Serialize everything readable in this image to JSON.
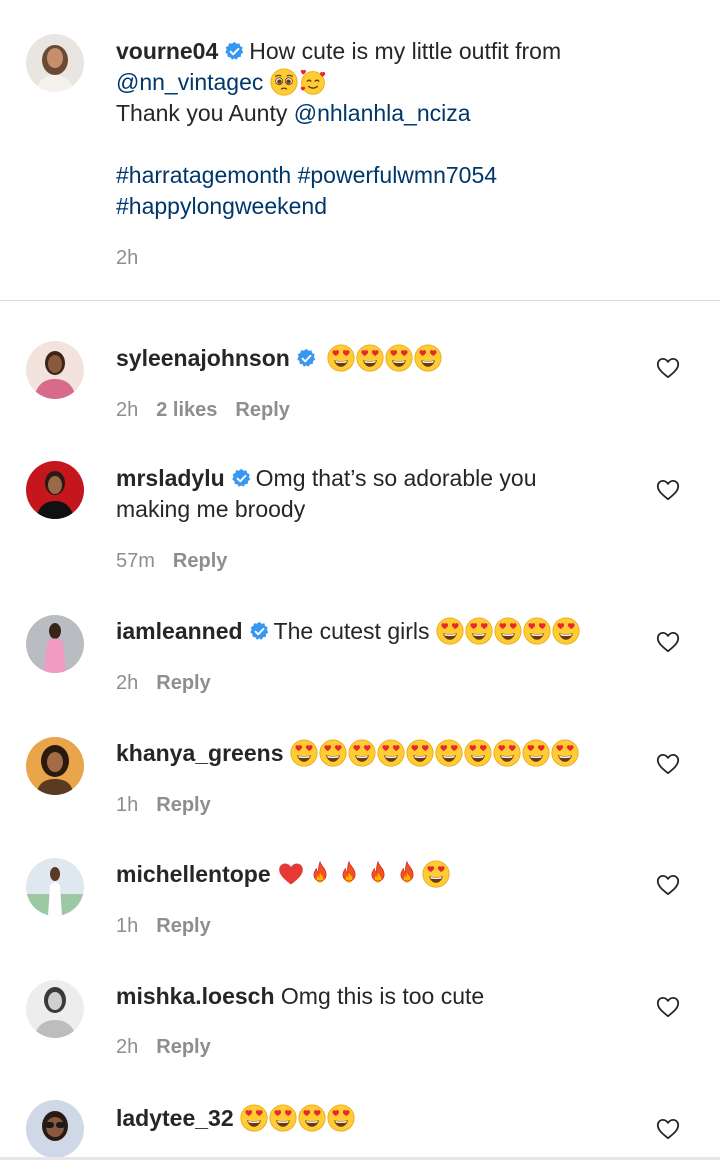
{
  "caption": {
    "username": "vourne04",
    "text_line1": "How cute is my little outfit from",
    "mention1": "@nn_vintagec",
    "text_line2": "Thank you Aunty",
    "mention2": "@nhlanhla_nciza",
    "hashtag1": "#harratagemonth",
    "hashtag2": "#powerfulwmn7054",
    "hashtag3": "#happylongweekend",
    "time": "2h",
    "verified": true,
    "emojis": [
      "pleading-face",
      "smiling-face-with-hearts"
    ]
  },
  "comments": [
    {
      "username": "syleenajohnson",
      "verified": true,
      "text": "",
      "emojis": [
        "heart-eyes",
        "heart-eyes",
        "heart-eyes",
        "heart-eyes"
      ],
      "time": "2h",
      "likes": "2 likes",
      "reply": "Reply"
    },
    {
      "username": "mrsladylu",
      "verified": true,
      "text_line1": "Omg that’s so adorable you",
      "text_line2": "making me broody",
      "time": "57m",
      "reply": "Reply"
    },
    {
      "username": "iamleanned",
      "verified": true,
      "text": "The cutest girls",
      "emojis": [
        "heart-eyes",
        "heart-eyes",
        "heart-eyes",
        "heart-eyes",
        "heart-eyes"
      ],
      "time": "2h",
      "reply": "Reply"
    },
    {
      "username": "khanya_greens",
      "verified": false,
      "text": "",
      "emojis": [
        "heart-eyes",
        "heart-eyes",
        "heart-eyes",
        "heart-eyes",
        "heart-eyes",
        "heart-eyes",
        "heart-eyes",
        "heart-eyes",
        "heart-eyes",
        "heart-eyes"
      ],
      "time": "1h",
      "reply": "Reply"
    },
    {
      "username": "michellentope",
      "verified": false,
      "text": "",
      "emojis": [
        "red-heart",
        "fire",
        "fire",
        "fire",
        "fire",
        "heart-eyes"
      ],
      "time": "1h",
      "reply": "Reply"
    },
    {
      "username": "mishka.loesch",
      "verified": false,
      "text": "Omg this is too cute",
      "time": "2h",
      "reply": "Reply"
    },
    {
      "username": "ladytee_32",
      "verified": false,
      "text": "",
      "emojis": [
        "heart-eyes",
        "heart-eyes",
        "heart-eyes",
        "heart-eyes"
      ]
    }
  ],
  "colors": {
    "link": "#00376b",
    "verified": "#3897f0",
    "muted": "#8e8e8e",
    "text": "#262626"
  }
}
